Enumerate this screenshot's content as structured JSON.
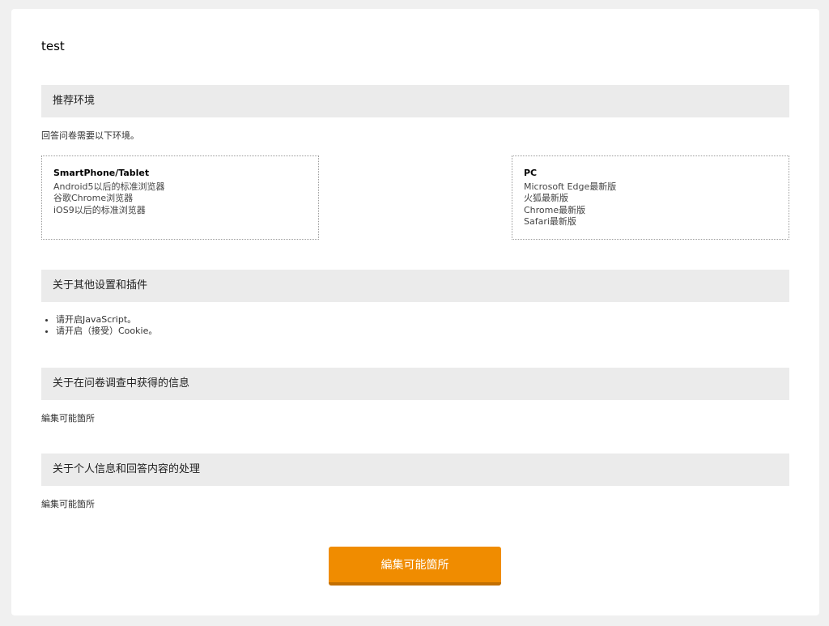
{
  "page": {
    "title": "test"
  },
  "sections": {
    "environment": {
      "header": "推荐环境",
      "intro": "回答问卷需要以下环境。",
      "mobile": {
        "title": "SmartPhone/Tablet",
        "lines": [
          "Android5以后的标准浏览器",
          "谷歌Chrome浏览器",
          "iOS9以后的标准浏览器"
        ]
      },
      "pc": {
        "title": "PC",
        "lines": [
          "Microsoft Edge最新版",
          "火狐最新版",
          "Chrome最新版",
          "Safari最新版"
        ]
      }
    },
    "settings": {
      "header": "关于其他设置和插件",
      "bullets": [
        "请开启JavaScript。",
        "请开启（接受）Cookie。"
      ]
    },
    "info": {
      "header": "关于在问卷调查中获得的信息",
      "body": "編集可能箇所"
    },
    "privacy": {
      "header": "关于个人信息和回答内容的处理",
      "body": "編集可能箇所"
    }
  },
  "submit": {
    "label": "編集可能箇所"
  },
  "colors": {
    "background": "#f0f0f0",
    "card": "#ffffff",
    "section_header_bg": "#ebebeb",
    "button": "#f08c00",
    "button_shadow": "#c26f00"
  }
}
